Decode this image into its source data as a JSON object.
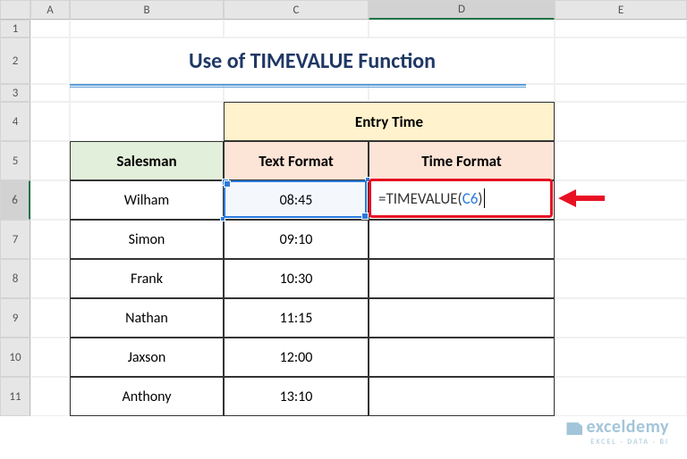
{
  "columns": [
    "A",
    "B",
    "C",
    "D",
    "E"
  ],
  "rows": [
    "1",
    "2",
    "3",
    "4",
    "5",
    "6",
    "7",
    "8",
    "9",
    "10",
    "11"
  ],
  "title": "Use of TIMEVALUE Function",
  "headers": {
    "salesman": "Salesman",
    "entry": "Entry Time",
    "text": "Text Format",
    "time": "Time Format"
  },
  "data": {
    "0": {
      "name": "Wilham",
      "text": "08:45",
      "time": ""
    },
    "1": {
      "name": "Simon",
      "text": "09:10",
      "time": ""
    },
    "2": {
      "name": "Frank",
      "text": "10:30",
      "time": ""
    },
    "3": {
      "name": "Nathan",
      "text": "11:15",
      "time": ""
    },
    "4": {
      "name": "Jaxson",
      "text": "12:00",
      "time": ""
    },
    "5": {
      "name": "Anthony",
      "text": "13:10",
      "time": ""
    }
  },
  "formula": {
    "eq": "=",
    "fn": "TIMEVALUE(",
    "ref": "C6",
    "close": ")"
  },
  "active": {
    "col": "D",
    "row": "6"
  },
  "watermark": {
    "brand": "exceldemy",
    "tag": "EXCEL · DATA · BI"
  },
  "chart_data": null
}
